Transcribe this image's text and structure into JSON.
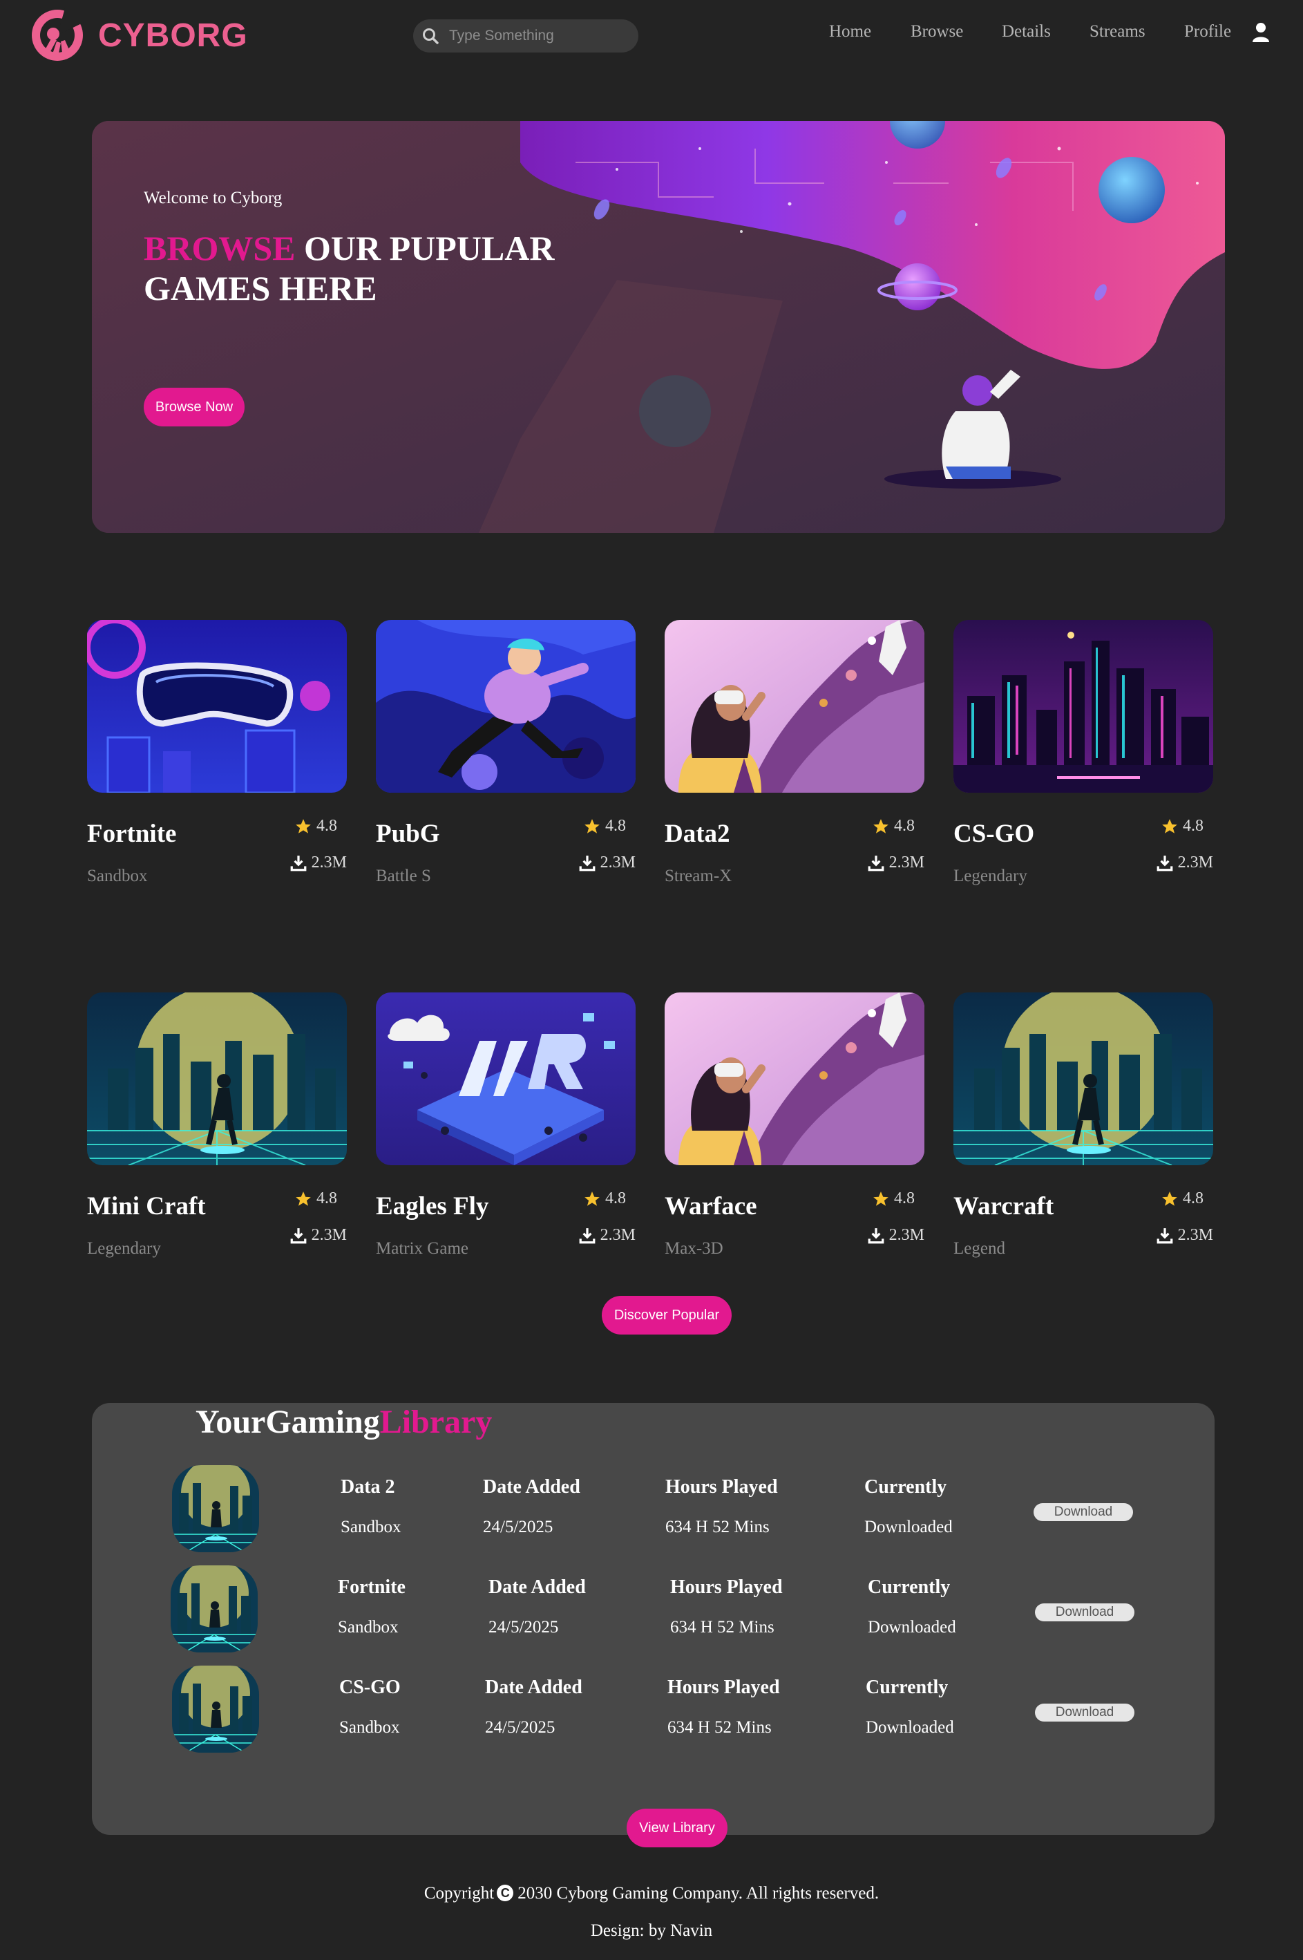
{
  "header": {
    "logo_text": "CYBORG",
    "search_placeholder": "Type Something",
    "nav": [
      "Home",
      "Browse",
      "Details",
      "Streams",
      "Profile"
    ]
  },
  "hero": {
    "welcome": "Welcome to Cyborg",
    "heading_accent": "BROWSE",
    "heading_rest_line1": " OUR PUPULAR",
    "heading_line2": "GAMES HERE",
    "button": "Browse Now"
  },
  "games": [
    {
      "name": "Fortnite",
      "category": "Sandbox",
      "rating": "4.8",
      "downloads": "2.3M",
      "art": "vr-goggles"
    },
    {
      "name": "PubG",
      "category": "Battle S",
      "rating": "4.8",
      "downloads": "2.3M",
      "art": "floating-gamer"
    },
    {
      "name": "Data2",
      "category": "Stream-X",
      "rating": "4.8",
      "downloads": "2.3M",
      "art": "vr-girl"
    },
    {
      "name": "CS-GO",
      "category": "Legendary",
      "rating": "4.8",
      "downloads": "2.3M",
      "art": "neon-city"
    },
    {
      "name": "Mini Craft",
      "category": "Legendary",
      "rating": "4.8",
      "downloads": "2.3M",
      "art": "cyber-skater"
    },
    {
      "name": "Eagles Fly",
      "category": "Matrix Game",
      "rating": "4.8",
      "downloads": "2.3M",
      "art": "vr-isometric"
    },
    {
      "name": "Warface",
      "category": "Max-3D",
      "rating": "4.8",
      "downloads": "2.3M",
      "art": "vr-girl"
    },
    {
      "name": "Warcraft",
      "category": "Legend",
      "rating": "4.8",
      "downloads": "2.3M",
      "art": "cyber-skater"
    }
  ],
  "discover_button": "Discover Popular",
  "library": {
    "title_main": "YourGaming",
    "title_accent": "Library",
    "rows": [
      {
        "game": "Data 2",
        "category": "Sandbox",
        "date_label": "Date Added",
        "date": "24/5/2025",
        "hours_label": "Hours Played",
        "hours": "634 H 52 Mins",
        "status_label": "Currently",
        "status": "Downloaded",
        "button": "Download"
      },
      {
        "game": "Fortnite",
        "category": "Sandbox",
        "date_label": "Date Added",
        "date": "24/5/2025",
        "hours_label": "Hours Played",
        "hours": "634 H 52 Mins",
        "status_label": "Currently",
        "status": "Downloaded",
        "button": "Download"
      },
      {
        "game": "CS-GO",
        "category": "Sandbox",
        "date_label": "Date Added",
        "date": "24/5/2025",
        "hours_label": "Hours Played",
        "hours": "634 H 52 Mins",
        "status_label": "Currently",
        "status": "Downloaded",
        "button": "Download"
      }
    ],
    "view_button": "View Library"
  },
  "footer": {
    "copyright_prefix": "Copyright",
    "copyright_symbol": "C",
    "copyright_text": "2030 Cyborg Gaming Company. All rights reserved.",
    "design": "Design: by Navin"
  },
  "colors": {
    "accent": "#e2198f",
    "logo": "#ec6090",
    "background": "#232323",
    "panel": "#484848"
  }
}
